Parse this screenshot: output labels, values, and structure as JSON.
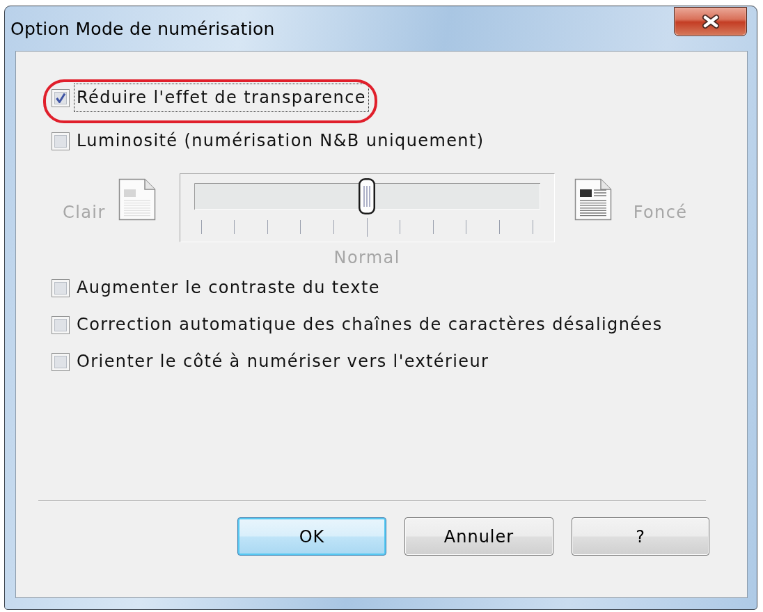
{
  "window": {
    "title": "Option Mode de numérisation"
  },
  "options": [
    {
      "kind": "checkbox",
      "label": "Réduire l'effet de transparence",
      "checked": true,
      "focused": true,
      "highlighted": true
    },
    {
      "kind": "checkbox",
      "label": "Luminosité (numérisation N&B uniquement)",
      "checked": false,
      "focused": false,
      "highlighted": false
    },
    {
      "kind": "slider",
      "disabled": true,
      "level": 0.5,
      "min_label": "Clair",
      "max_label": "Foncé",
      "center_label": "Normal"
    },
    {
      "kind": "checkbox",
      "label": "Augmenter le contraste du texte",
      "checked": false,
      "focused": false,
      "highlighted": false
    },
    {
      "kind": "checkbox",
      "label": "Correction automatique des chaînes de caractères désalignées",
      "checked": false,
      "focused": false,
      "highlighted": false
    },
    {
      "kind": "checkbox",
      "label": "Orienter le côté à numériser vers l'extérieur",
      "checked": false,
      "focused": false,
      "highlighted": false
    }
  ],
  "buttons": [
    {
      "label": "OK",
      "default": true
    },
    {
      "label": "Annuler",
      "default": false
    },
    {
      "label": "?",
      "default": false
    }
  ]
}
